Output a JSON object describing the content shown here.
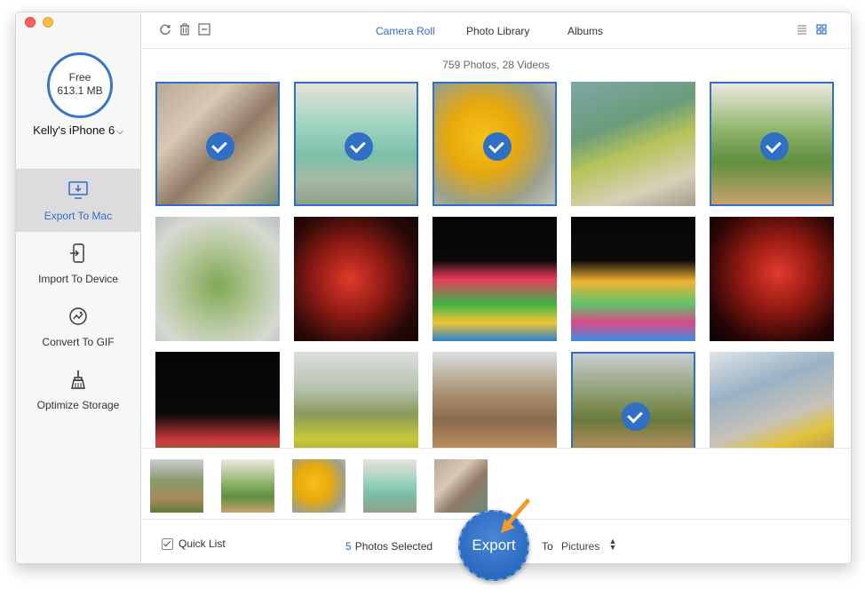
{
  "sidebar": {
    "storage": {
      "label": "Free",
      "value": "613.1 MB"
    },
    "device_name": "Kelly's iPhone 6",
    "items": [
      {
        "label": "Export To Mac",
        "icon": "monitor-download-icon",
        "active": true
      },
      {
        "label": "Import To Device",
        "icon": "phone-import-icon",
        "active": false
      },
      {
        "label": "Convert To GIF",
        "icon": "gif-convert-icon",
        "active": false
      },
      {
        "label": "Optimize Storage",
        "icon": "broom-icon",
        "active": false
      }
    ]
  },
  "toolbar": {
    "tabs": [
      {
        "label": "Camera Roll",
        "active": true
      },
      {
        "label": "Photo Library",
        "active": false
      },
      {
        "label": "Albums",
        "active": false
      }
    ],
    "icons": [
      "refresh-icon",
      "trash-icon",
      "minus-icon",
      "list-view-icon",
      "grid-view-icon"
    ]
  },
  "summary": "759 Photos, 28 Videos",
  "photos": [
    {
      "subject": "collage wall with bicycle",
      "selected": true
    },
    {
      "subject": "mint green building with car",
      "selected": true
    },
    {
      "subject": "yellow flowers",
      "selected": true
    },
    {
      "subject": "succulents with figurine",
      "selected": false
    },
    {
      "subject": "potted plant",
      "selected": true
    },
    {
      "subject": "terrarium",
      "selected": false
    },
    {
      "subject": "red lanterns at night",
      "selected": false
    },
    {
      "subject": "lantern festival horses",
      "selected": false
    },
    {
      "subject": "lantern festival horses 2",
      "selected": false
    },
    {
      "subject": "red lanterns",
      "selected": false
    },
    {
      "subject": "night figure lantern",
      "selected": false
    },
    {
      "subject": "rapeseed field",
      "selected": false
    },
    {
      "subject": "village houses",
      "selected": false
    },
    {
      "subject": "village garden",
      "selected": true
    },
    {
      "subject": "elephant sculpture",
      "selected": false
    }
  ],
  "quick_list": {
    "label": "Quick List",
    "checked": true,
    "thumbnails": [
      "village garden",
      "potted plant",
      "yellow flowers",
      "mint green building with car",
      "collage wall with bicycle"
    ]
  },
  "footer": {
    "selected_count": "5",
    "selected_text": "Photos Selected",
    "to_label": "To",
    "destination": "Pictures",
    "export_label": "Export"
  },
  "colors": {
    "accent": "#2f6fc4",
    "arrow": "#f39a2b"
  }
}
